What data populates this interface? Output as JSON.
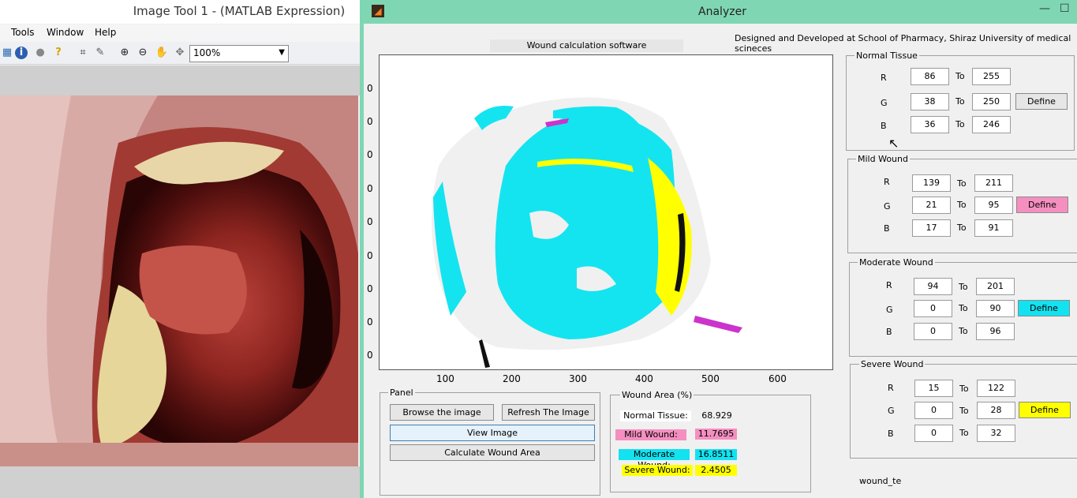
{
  "image_tool": {
    "title": "Image Tool 1 - (MATLAB Expression)",
    "menu": [
      "Tools",
      "Window",
      "Help"
    ],
    "zoom": "100%"
  },
  "analyzer": {
    "title": "Analyzer",
    "credit": "Designed and Developed at School of Pharmacy, Shiraz University of medical scineces",
    "plot_title": "Wound calculation software",
    "yticks": [
      "0",
      "0",
      "0",
      "0",
      "0",
      "0",
      "0",
      "0",
      "0"
    ],
    "xticks": [
      "100",
      "200",
      "300",
      "400",
      "500",
      "600"
    ],
    "panels": {
      "normal": {
        "title": "Normal Tissue",
        "R": [
          "86",
          "255"
        ],
        "G": [
          "38",
          "250"
        ],
        "B": [
          "36",
          "246"
        ],
        "define": "Define",
        "color": "#e6e6e6"
      },
      "mild": {
        "title": "Mild Wound",
        "R": [
          "139",
          "211"
        ],
        "G": [
          "21",
          "95"
        ],
        "B": [
          "17",
          "91"
        ],
        "define": "Define",
        "color": "#f58fc0"
      },
      "moderate": {
        "title": "Moderate Wound",
        "R": [
          "94",
          "201"
        ],
        "G": [
          "0",
          "90"
        ],
        "B": [
          "0",
          "96"
        ],
        "define": "Define",
        "color": "#13e2f0"
      },
      "severe": {
        "title": "Severe Wound",
        "R": [
          "15",
          "122"
        ],
        "G": [
          "0",
          "28"
        ],
        "B": [
          "0",
          "32"
        ],
        "define": "Define",
        "color": "#ffff00"
      }
    },
    "labels": {
      "r": "R",
      "g": "G",
      "b": "B",
      "to": "To"
    },
    "control_panel": {
      "title": "Panel",
      "browse": "Browse the image",
      "refresh": "Refresh The Image",
      "view": "View Image",
      "calculate": "Calculate Wound Area"
    },
    "wound_area": {
      "title": "Wound Area (%)",
      "normal_label": "Normal Tissue:",
      "normal_value": "68.929",
      "mild_label": "Mild Wound:",
      "mild_value": "11.7695",
      "moderate_label": "Moderate Wound:",
      "moderate_value": "16.8511",
      "severe_label": "Severe Wound:",
      "severe_value": "2.4505"
    },
    "footer_text": "wound_te"
  }
}
